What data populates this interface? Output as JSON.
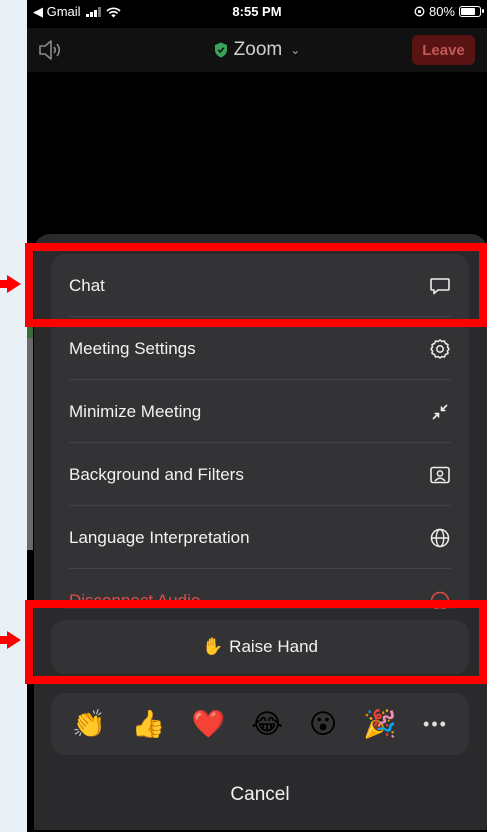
{
  "status_bar": {
    "back_app": "◀ Gmail",
    "time": "8:55 PM",
    "battery_text": "80%",
    "battery_level": 0.8
  },
  "header": {
    "title": "Zoom",
    "leave_label": "Leave"
  },
  "menu": {
    "items": [
      {
        "label": "Chat",
        "icon": "chat-bubble-icon"
      },
      {
        "label": "Meeting Settings",
        "icon": "gear-icon"
      },
      {
        "label": "Minimize Meeting",
        "icon": "minimize-arrows-icon"
      },
      {
        "label": "Background and Filters",
        "icon": "person-frame-icon"
      },
      {
        "label": "Language Interpretation",
        "icon": "globe-icon"
      },
      {
        "label": "Disconnect Audio",
        "icon": "circle-icon"
      }
    ]
  },
  "raise_hand": {
    "emoji": "✋",
    "label": "Raise Hand"
  },
  "reactions": [
    "👏",
    "👍",
    "❤️",
    "😂",
    "😮",
    "🎉",
    "•••"
  ],
  "cancel_label": "Cancel",
  "colors": {
    "highlight": "#ff0000",
    "leave": "#5a1313",
    "danger": "#e34b4b"
  }
}
